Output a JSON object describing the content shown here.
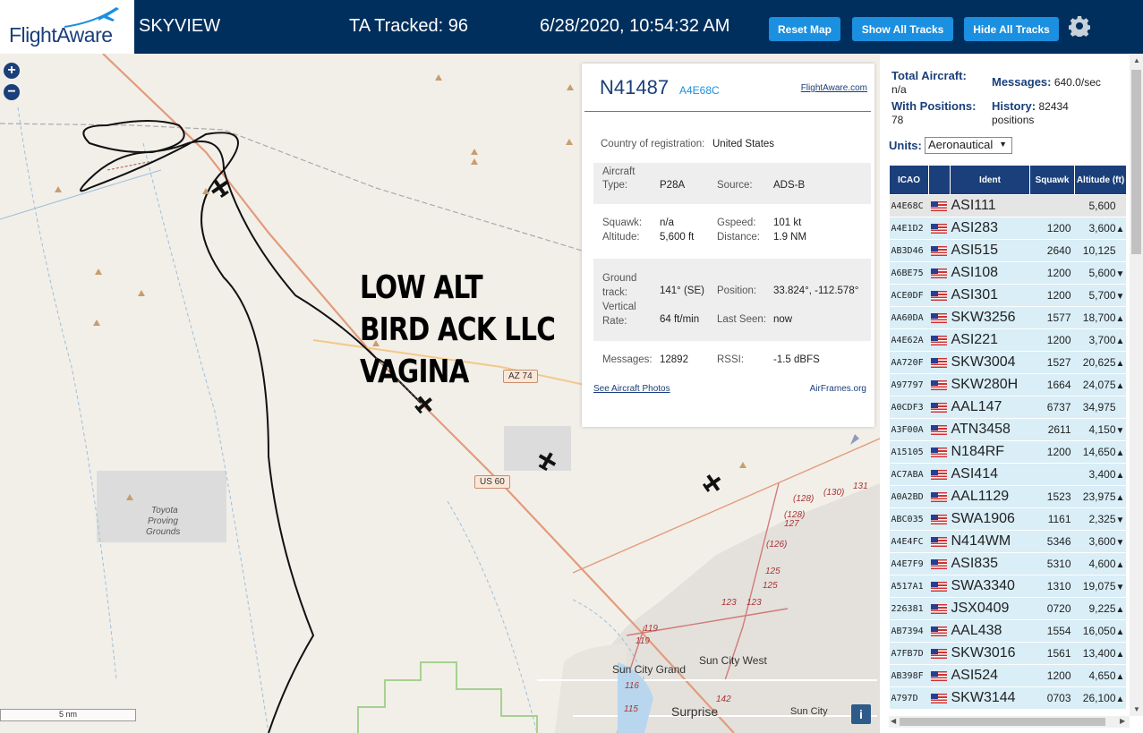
{
  "header": {
    "logo_text": "FlightAware",
    "app_title": "SKYVIEW",
    "tracked": "TA Tracked: 96",
    "datetime": "6/28/2020, 10:54:32 AM",
    "buttons": {
      "reset": "Reset Map",
      "show": "Show All Tracks",
      "hide": "Hide All Tracks"
    }
  },
  "map": {
    "overlay_text": [
      "LOW ALT",
      "BIRD ACK LLC",
      "VAGINA"
    ],
    "scale_label": "5 nm",
    "places": [
      "Toyota",
      "Proving",
      "Grounds",
      "Sun City Grand",
      "Sun City West",
      "Surprise",
      "Sun City"
    ],
    "road_shields": [
      "AZ 74",
      "US 60"
    ],
    "route_numbers": [
      "(128)",
      "(130)",
      "131",
      "(128)",
      "127",
      "(126)",
      "125",
      "125",
      "123",
      "123",
      "119",
      "119",
      "116",
      "115",
      "142"
    ]
  },
  "popup": {
    "callsign": "N41487",
    "hex": "A4E68C",
    "fa_link": "FlightAware.com",
    "country_label": "Country of registration:",
    "country_value": "United States",
    "aircraft_type_label": "Aircraft Type:",
    "aircraft_type_value": "P28A",
    "source_label": "Source:",
    "source_value": "ADS-B",
    "squawk_label": "Squawk:",
    "squawk_value": "n/a",
    "gspeed_label": "Gspeed:",
    "gspeed_value": "101 kt",
    "altitude_label": "Altitude:",
    "altitude_value": "5,600 ft",
    "distance_label": "Distance:",
    "distance_value": "1.9 NM",
    "ground_track_label": "Ground track:",
    "ground_track_value": "141° (SE)",
    "position_label": "Position:",
    "position_value": "33.824°, -112.578°",
    "vrate_label": "Vertical Rate:",
    "vrate_value": "64 ft/min",
    "last_seen_label": "Last Seen:",
    "last_seen_value": "now",
    "messages_label": "Messages:",
    "messages_value": "12892",
    "rssi_label": "RSSI:",
    "rssi_value": "-1.5 dBFS",
    "photos_link": "See Aircraft Photos",
    "airframes_link": "AirFrames.org"
  },
  "panel": {
    "total_label": "Total Aircraft:",
    "total_value": "n/a",
    "with_pos_label": "With Positions:",
    "with_pos_value": "78",
    "messages_label": "Messages:",
    "messages_value": "640.0/sec",
    "history_label": "History:",
    "history_value": "82434 positions",
    "units_label": "Units:",
    "units_value": "Aeronautical",
    "columns": [
      "ICAO",
      "Ident",
      "Squawk",
      "Altitude (ft)"
    ],
    "rows": [
      {
        "icao": "A4E68C",
        "ident": "ASI111",
        "squawk": "",
        "alt": "5,600",
        "trend": ""
      },
      {
        "icao": "A4E1D2",
        "ident": "ASI283",
        "squawk": "1200",
        "alt": "3,600",
        "trend": "▲"
      },
      {
        "icao": "AB3D46",
        "ident": "ASI515",
        "squawk": "2640",
        "alt": "10,125",
        "trend": ""
      },
      {
        "icao": "A6BE75",
        "ident": "ASI108",
        "squawk": "1200",
        "alt": "5,600",
        "trend": "▼"
      },
      {
        "icao": "ACE0DF",
        "ident": "ASI301",
        "squawk": "1200",
        "alt": "5,700",
        "trend": "▼"
      },
      {
        "icao": "AA60DA",
        "ident": "SKW3256",
        "squawk": "1577",
        "alt": "18,700",
        "trend": "▲"
      },
      {
        "icao": "A4E62A",
        "ident": "ASI221",
        "squawk": "1200",
        "alt": "3,700",
        "trend": "▲"
      },
      {
        "icao": "AA720F",
        "ident": "SKW3004",
        "squawk": "1527",
        "alt": "20,625",
        "trend": "▲"
      },
      {
        "icao": "A97797",
        "ident": "SKW280H",
        "squawk": "1664",
        "alt": "24,075",
        "trend": "▲"
      },
      {
        "icao": "A0CDF3",
        "ident": "AAL147",
        "squawk": "6737",
        "alt": "34,975",
        "trend": ""
      },
      {
        "icao": "A3F00A",
        "ident": "ATN3458",
        "squawk": "2611",
        "alt": "4,150",
        "trend": "▼"
      },
      {
        "icao": "A15105",
        "ident": "N184RF",
        "squawk": "1200",
        "alt": "14,650",
        "trend": "▲"
      },
      {
        "icao": "AC7ABA",
        "ident": "ASI414",
        "squawk": "",
        "alt": "3,400",
        "trend": "▲"
      },
      {
        "icao": "A0A2BD",
        "ident": "AAL1129",
        "squawk": "1523",
        "alt": "23,975",
        "trend": "▲"
      },
      {
        "icao": "ABC035",
        "ident": "SWA1906",
        "squawk": "1161",
        "alt": "2,325",
        "trend": "▼"
      },
      {
        "icao": "A4E4FC",
        "ident": "N414WM",
        "squawk": "5346",
        "alt": "3,600",
        "trend": "▼"
      },
      {
        "icao": "A4E7F9",
        "ident": "ASI835",
        "squawk": "5310",
        "alt": "4,600",
        "trend": "▲"
      },
      {
        "icao": "A517A1",
        "ident": "SWA3340",
        "squawk": "1310",
        "alt": "19,075",
        "trend": "▼"
      },
      {
        "icao": "226381",
        "ident": "JSX0409",
        "squawk": "0720",
        "alt": "9,225",
        "trend": "▲"
      },
      {
        "icao": "AB7394",
        "ident": "AAL438",
        "squawk": "1554",
        "alt": "16,050",
        "trend": "▲"
      },
      {
        "icao": "A7FB7D",
        "ident": "SKW3016",
        "squawk": "1561",
        "alt": "13,400",
        "trend": "▲"
      },
      {
        "icao": "AB398F",
        "ident": "ASI524",
        "squawk": "1200",
        "alt": "4,650",
        "trend": "▲"
      },
      {
        "icao": "A797D",
        "ident": "SKW3144",
        "squawk": "0703",
        "alt": "26,100",
        "trend": "▲"
      }
    ]
  }
}
